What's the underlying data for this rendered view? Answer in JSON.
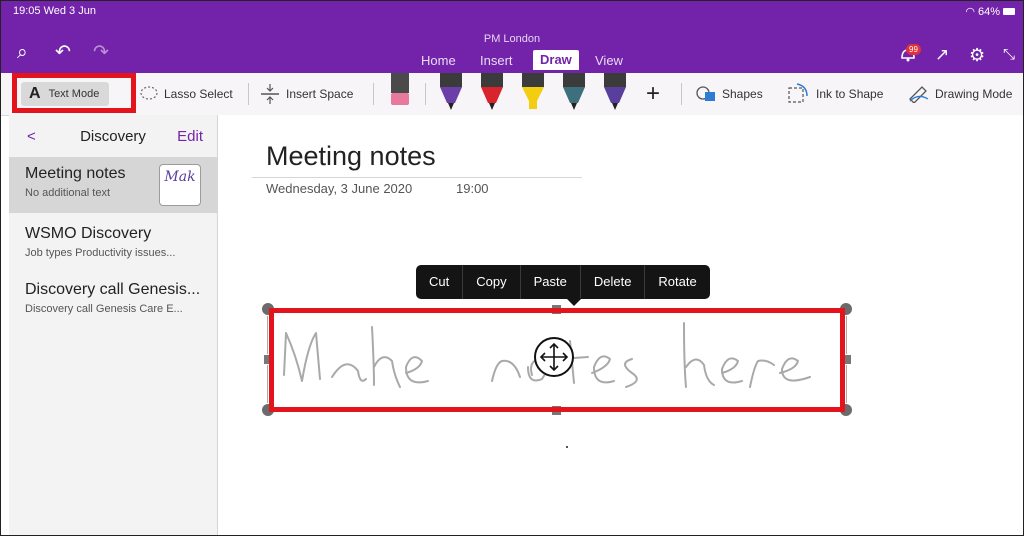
{
  "status_bar": {
    "time": "19:05  Wed 3 Jun",
    "battery": "64%"
  },
  "window": {
    "title": "PM London"
  },
  "tabs": [
    {
      "label": "Home",
      "active": false
    },
    {
      "label": "Insert",
      "active": false
    },
    {
      "label": "Draw",
      "active": true
    },
    {
      "label": "View",
      "active": false
    }
  ],
  "notification_count": "99",
  "toolbar": {
    "text_mode": "Text Mode",
    "lasso_select": "Lasso Select",
    "insert_space": "Insert Space",
    "add": "+",
    "shapes": "Shapes",
    "ink_to_shape": "Ink to Shape",
    "drawing_mode": "Drawing Mode",
    "pens": [
      {
        "name": "eraser",
        "color": "#e77a9c"
      },
      {
        "name": "pen-purple",
        "color": "#6b3ea8"
      },
      {
        "name": "pen-red",
        "color": "#d9232d"
      },
      {
        "name": "highlighter-yellow",
        "color": "#f2cd10"
      },
      {
        "name": "pen-teal",
        "color": "#3d6f7d"
      },
      {
        "name": "pen-violet",
        "color": "#5a3e9e"
      }
    ]
  },
  "sidebar": {
    "back": "<",
    "title": "Discovery",
    "edit": "Edit",
    "pages": [
      {
        "title": "Meeting notes",
        "subtitle": "No additional text",
        "thumb_text": "Mak",
        "selected": true
      },
      {
        "title": "WSMO Discovery",
        "subtitle": "Job types  Productivity issues...",
        "selected": false
      },
      {
        "title": "Discovery call Genesis...",
        "subtitle": "Discovery call Genesis Care E...",
        "selected": false
      }
    ]
  },
  "note": {
    "title": "Meeting notes",
    "date": "Wednesday, 3 June 2020",
    "time": "19:00"
  },
  "context_menu": {
    "items": [
      "Cut",
      "Copy",
      "Paste",
      "Delete",
      "Rotate"
    ]
  },
  "colors": {
    "accent": "#7323a9",
    "highlight": "#e3141c"
  }
}
